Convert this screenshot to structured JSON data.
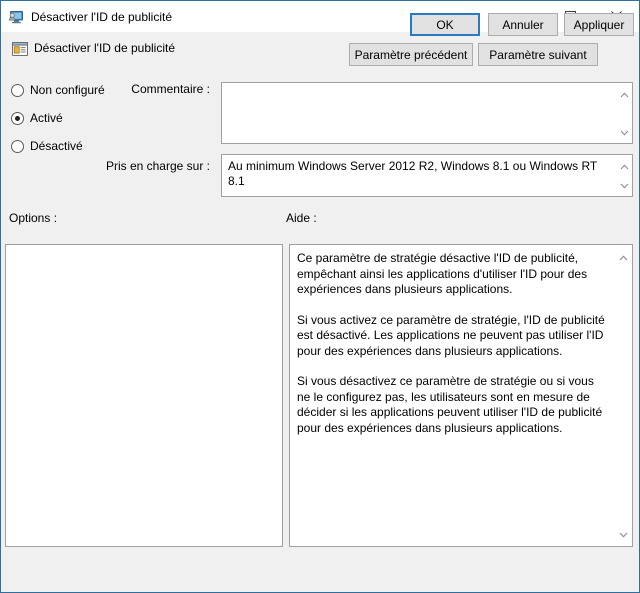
{
  "window": {
    "title": "Désactiver l'ID de publicité",
    "title_icon": "computer-policy-icon",
    "controls": {
      "minimize": "minimize-icon",
      "maximize": "maximize-icon",
      "close": "close-icon"
    },
    "accent_border_color": "#2f6f9f",
    "background_color": "#f0f0f0"
  },
  "header": {
    "icon": "policy-setting-icon",
    "title": "Désactiver l'ID de publicité",
    "prev_button": "Paramètre précédent",
    "next_button": "Paramètre suivant"
  },
  "state_options": {
    "items": [
      {
        "label": "Non configuré",
        "selected": false
      },
      {
        "label": "Activé",
        "selected": true
      },
      {
        "label": "Désactivé",
        "selected": false
      }
    ]
  },
  "fields": {
    "comment_label": "Commentaire :",
    "comment_value": "",
    "supported_label": "Pris en charge sur :",
    "supported_value": "Au minimum Windows Server 2012 R2, Windows 8.1 ou Windows RT 8.1"
  },
  "sections": {
    "options_label": "Options :",
    "options_content": "",
    "help_label": "Aide :",
    "help_paragraphs": [
      "Ce paramètre de stratégie désactive l'ID de publicité, empêchant ainsi les applications d'utiliser l'ID pour des expériences dans plusieurs applications.",
      "Si vous activez ce paramètre de stratégie, l'ID de publicité est désactivé. Les applications ne peuvent pas utiliser l'ID pour des expériences dans plusieurs applications.",
      "Si vous désactivez ce paramètre de stratégie ou si vous ne le configurez pas, les utilisateurs sont en mesure de décider si les applications peuvent utiliser l'ID de publicité pour des expériences dans plusieurs applications."
    ]
  },
  "footer": {
    "ok": "OK",
    "cancel": "Annuler",
    "apply": "Appliquer",
    "default_focus_color": "#2a7ac0"
  },
  "scrollbars": {
    "up_arrow": "chevron-up-icon",
    "down_arrow": "chevron-down-icon"
  }
}
